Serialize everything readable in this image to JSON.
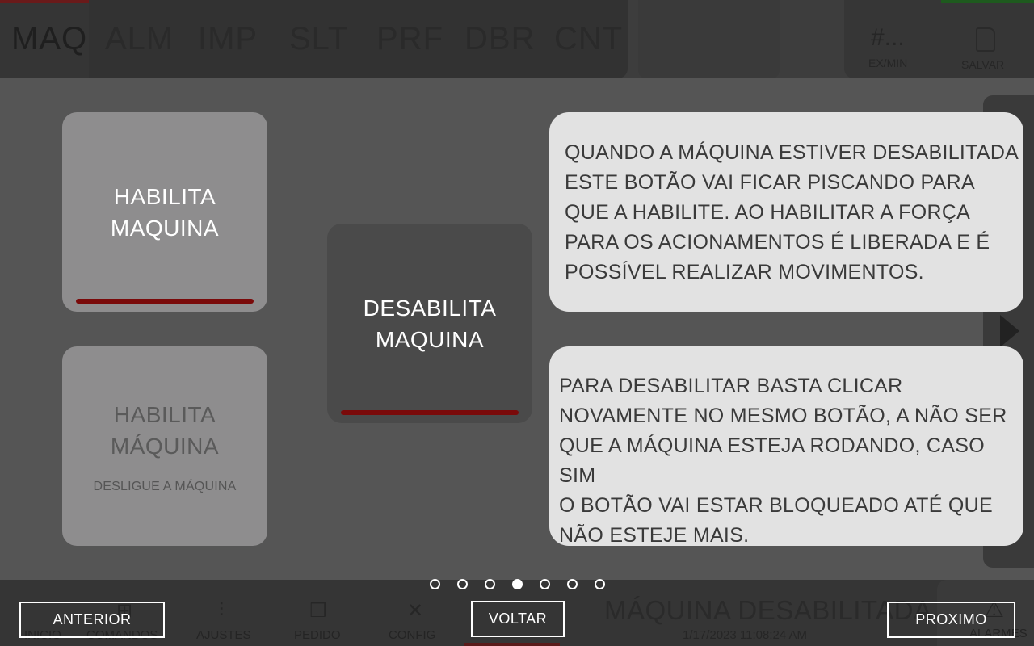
{
  "background": {
    "tabs": [
      "MAQ",
      "ALM",
      "IMP",
      "SLT",
      "PRF",
      "DBR",
      "CNT"
    ],
    "counter": {
      "value": "#...",
      "label": "EX/MIN"
    },
    "save_label": "SALVAR",
    "bottom_nav": [
      "INICIO",
      "COMANDOS",
      "AJUSTES",
      "PEDIDO",
      "CONFIG"
    ],
    "alarm_label": "ALARMES",
    "status": "MÁQUINA DESABILITADA",
    "timestamp": "1/17/2023 11:08:24 AM"
  },
  "tutorial": {
    "demo_enable": {
      "label": "HABILITA\nMAQUINA"
    },
    "demo_disable": {
      "label": "DESABILITA\nMAQUINA"
    },
    "demo_blocked": {
      "label": "HABILITA\nMÁQUINA",
      "sublabel": "DESLIGUE A MÁQUINA"
    },
    "bubble_1": "QUANDO A MÁQUINA ESTIVER DESABILITADA\nESTE BOTÃO VAI FICAR PISCANDO PARA\nQUE A HABILITE. AO HABILITAR  A FORÇA\nPARA OS ACIONAMENTOS É LIBERADA E É\nPOSSÍVEL REALIZAR MOVIMENTOS.",
    "bubble_2": "PARA DESABILITAR BASTA CLICAR\nNOVAMENTE NO MESMO BOTÃO, A NÃO SER\nQUE A MÁQUINA ESTEJA RODANDO, CASO SIM\nO BOTÃO VAI ESTAR BLOQUEADO ATÉ QUE\nNÃO ESTEJE MAIS.",
    "page_total": 7,
    "page_current": 4,
    "buttons": {
      "previous": "ANTERIOR",
      "back": "VOLTAR",
      "next": "PROXIMO"
    }
  },
  "colors": {
    "overlay_bg": "#555555",
    "bubble_bg": "#e2e2e2",
    "enable_bar": "#7a0a0a",
    "button_border": "#ffffff"
  }
}
